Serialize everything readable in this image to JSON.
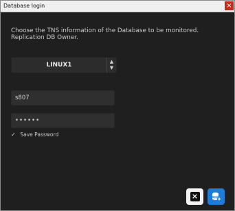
{
  "window": {
    "title": "Database login",
    "close_glyph": "×"
  },
  "prompt": "Choose the TNS information of the Database to be monitored. Replication DB Owner.",
  "database": {
    "selected": "LINUX1"
  },
  "username": {
    "value": "s807"
  },
  "password": {
    "value": "••••••"
  },
  "save_password": {
    "label": "Save Password",
    "checked": true,
    "check_glyph": "✓"
  },
  "buttons": {
    "cancel_glyph": "×"
  },
  "colors": {
    "background": "#1f1f1f",
    "accent": "#1f7bd3",
    "close": "#c42b1c"
  },
  "icons": {
    "close": "close-icon",
    "dropdown": "chevron-up-down-icon",
    "checkmark": "checkmark-icon",
    "cancel": "x-icon",
    "add_database": "database-add-icon"
  }
}
